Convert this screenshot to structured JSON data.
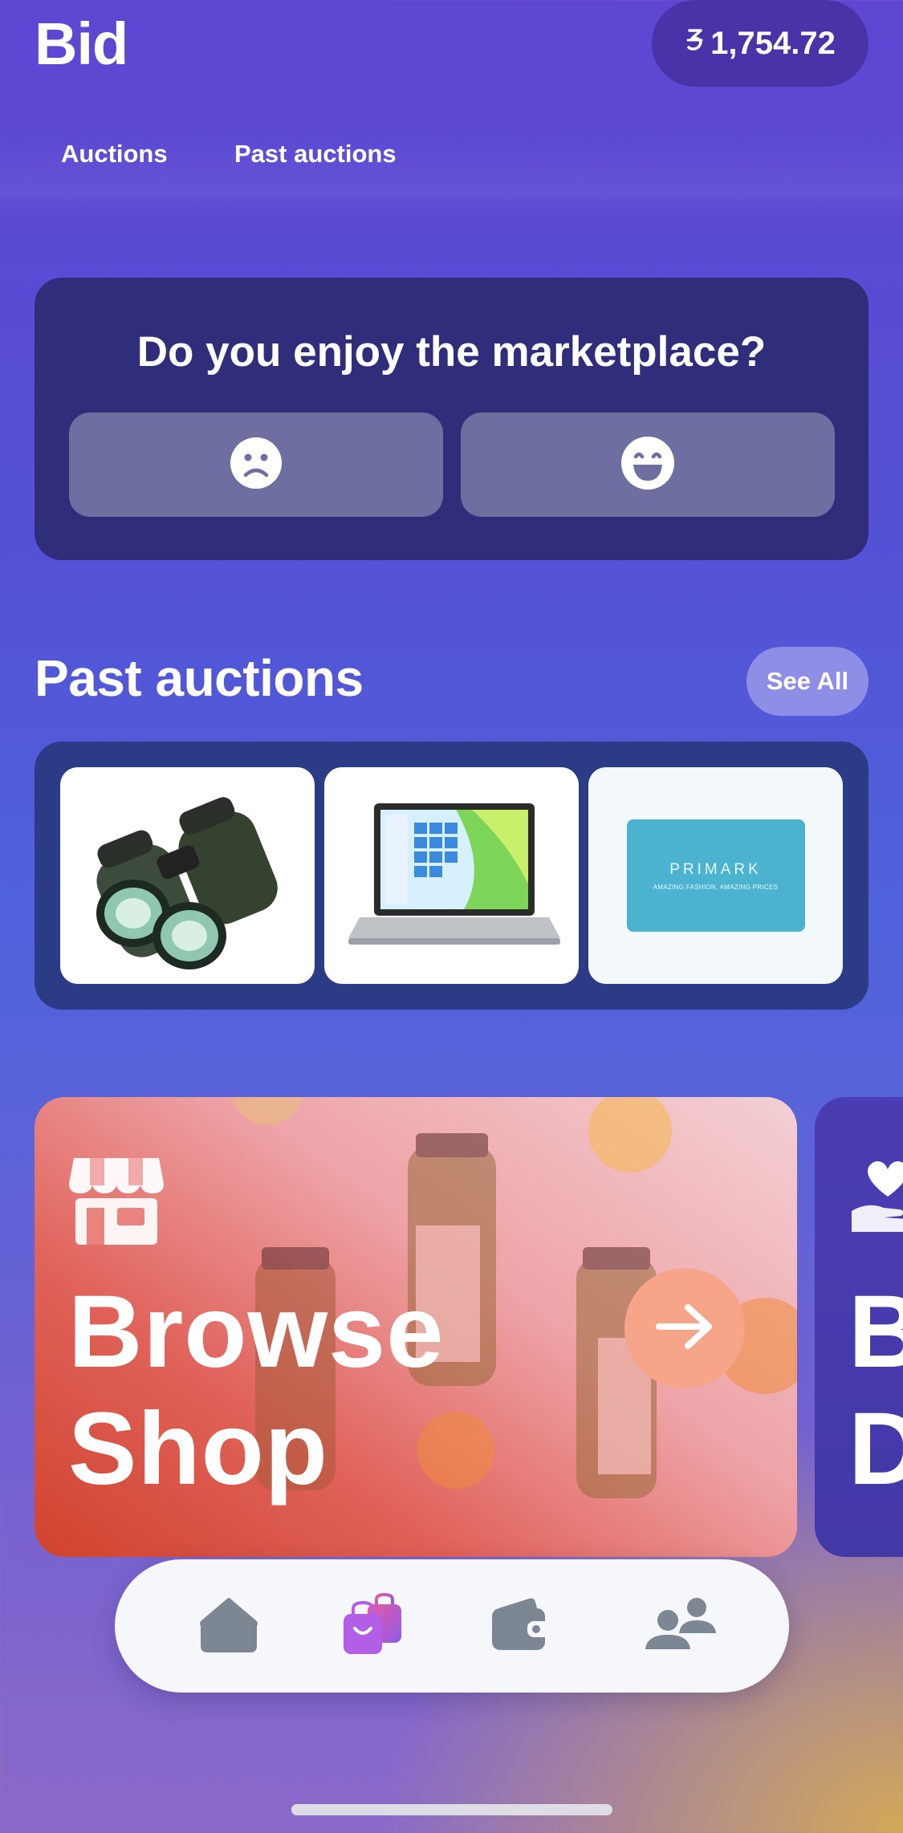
{
  "header": {
    "title": "Bid",
    "balance": "1,754.72",
    "currency_icon": "coin-currency-icon"
  },
  "tabs": [
    {
      "label": "Auctions"
    },
    {
      "label": "Past auctions"
    }
  ],
  "feedback": {
    "question": "Do you enjoy the marketplace?",
    "negative_icon": "sad-face-icon",
    "positive_icon": "happy-face-icon"
  },
  "past_auctions": {
    "title": "Past auctions",
    "see_all_label": "See All",
    "items": [
      {
        "image": "binoculars-image"
      },
      {
        "image": "laptop-image"
      },
      {
        "image": "gift-card-image",
        "brand": "PRIMARK",
        "tagline": "AMAZING FASHION, AMAZING PRICES"
      }
    ]
  },
  "promos": [
    {
      "title_line1": "Browse",
      "title_line2": "Shop",
      "icon": "storefront-icon"
    },
    {
      "title_line1": "B",
      "title_line2": "D",
      "icon": "hand-heart-icon"
    }
  ],
  "bottom_nav": [
    {
      "icon": "home-icon"
    },
    {
      "icon": "shopping-bags-icon",
      "active": true
    },
    {
      "icon": "wallet-icon"
    },
    {
      "icon": "people-icon"
    }
  ],
  "colors": {
    "active_nav": "#b25ee6",
    "inactive_nav": "#7d8794"
  }
}
